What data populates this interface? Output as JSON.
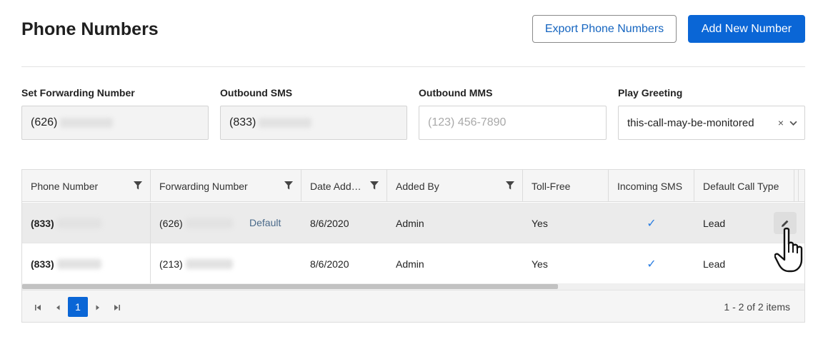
{
  "header": {
    "title": "Phone Numbers",
    "export_label": "Export Phone Numbers",
    "add_label": "Add New Number"
  },
  "settings": {
    "forwarding": {
      "label": "Set Forwarding Number",
      "value": "(626)"
    },
    "outbound_sms": {
      "label": "Outbound SMS",
      "value": "(833)"
    },
    "outbound_mms": {
      "label": "Outbound MMS",
      "placeholder": "(123) 456-7890"
    },
    "greeting": {
      "label": "Play Greeting",
      "value": "this-call-may-be-monitored"
    }
  },
  "grid": {
    "columns": [
      "Phone Number",
      "Forwarding Number",
      "Date Add…",
      "Added By",
      "Toll-Free",
      "Incoming SMS",
      "Default Call Type"
    ],
    "rows": [
      {
        "phone": "(833)",
        "forwarding": "(626)",
        "badge": "Default",
        "date": "8/6/2020",
        "added_by": "Admin",
        "toll_free": "Yes",
        "incoming_sms": "✓",
        "call_type": "Lead"
      },
      {
        "phone": "(833)",
        "forwarding": "(213)",
        "badge": "",
        "date": "8/6/2020",
        "added_by": "Admin",
        "toll_free": "Yes",
        "incoming_sms": "✓",
        "call_type": "Lead"
      }
    ]
  },
  "pager": {
    "current_page": "1",
    "info": "1 - 2 of 2 items"
  },
  "colors": {
    "primary": "#0a66d6",
    "check": "#2a7de1"
  },
  "icons": [
    "filter-icon",
    "edit-icon",
    "clear-icon",
    "chevron-down-icon",
    "first-page-icon",
    "prev-page-icon",
    "next-page-icon",
    "last-page-icon",
    "hand-cursor-icon"
  ]
}
